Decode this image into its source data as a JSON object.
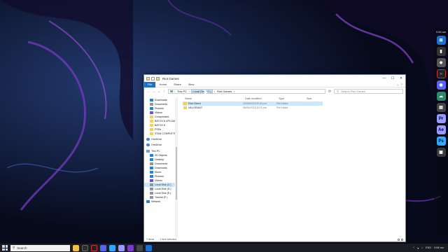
{
  "window": {
    "title": "Riot Games",
    "controls": {
      "minimize": "—",
      "maximize": "☐",
      "close": "✕"
    }
  },
  "ribbon": {
    "tabs": [
      "File",
      "Home",
      "Share",
      "View"
    ]
  },
  "address": {
    "crumbs": [
      "This PC",
      "Local Disk (C:)",
      "Riot Games"
    ],
    "search_placeholder": "Search Riot Games"
  },
  "nav": {
    "quick_access": [
      "Downloads",
      "Documents",
      "Pictures",
      "Videos",
      "Compressed",
      "BATCH 8 UPLOAD",
      "BATCH 8",
      "PSDs",
      "STAN COMPLETE"
    ],
    "onedrive": [
      "OneDrive",
      "OneDrive"
    ],
    "this_pc": [
      "This PC",
      "3D Objects",
      "Desktop",
      "Documents",
      "Downloads",
      "Music",
      "Pictures",
      "Videos",
      "Local Disk (C:)",
      "Local Disk (D:)",
      "Local Disk (E:)",
      "Tutorial (F:)",
      "Network"
    ]
  },
  "files": {
    "columns": [
      "Name",
      "Date modified",
      "Type",
      "Size"
    ],
    "rows": [
      {
        "name": "Riot Client",
        "date": "22/08/2023 8:15 pm",
        "type": "File folder",
        "selected": true
      },
      {
        "name": "VALORANT",
        "date": "08/05/2023 8:21 pm",
        "type": "File folder",
        "selected": false
      }
    ]
  },
  "status": {
    "items": "2 items",
    "selected": "1 item selected"
  },
  "taskbar": {
    "search_label": "Search",
    "tray": {
      "lang": "ENG",
      "time": "9:58 am"
    }
  },
  "dock": {
    "time": "9:58 am",
    "apps": [
      "Pr",
      "Ae",
      "Ps"
    ]
  },
  "colors": {
    "accent": "#1a73c7",
    "selection": "#cce8ff",
    "folder": "#f3cf60"
  }
}
